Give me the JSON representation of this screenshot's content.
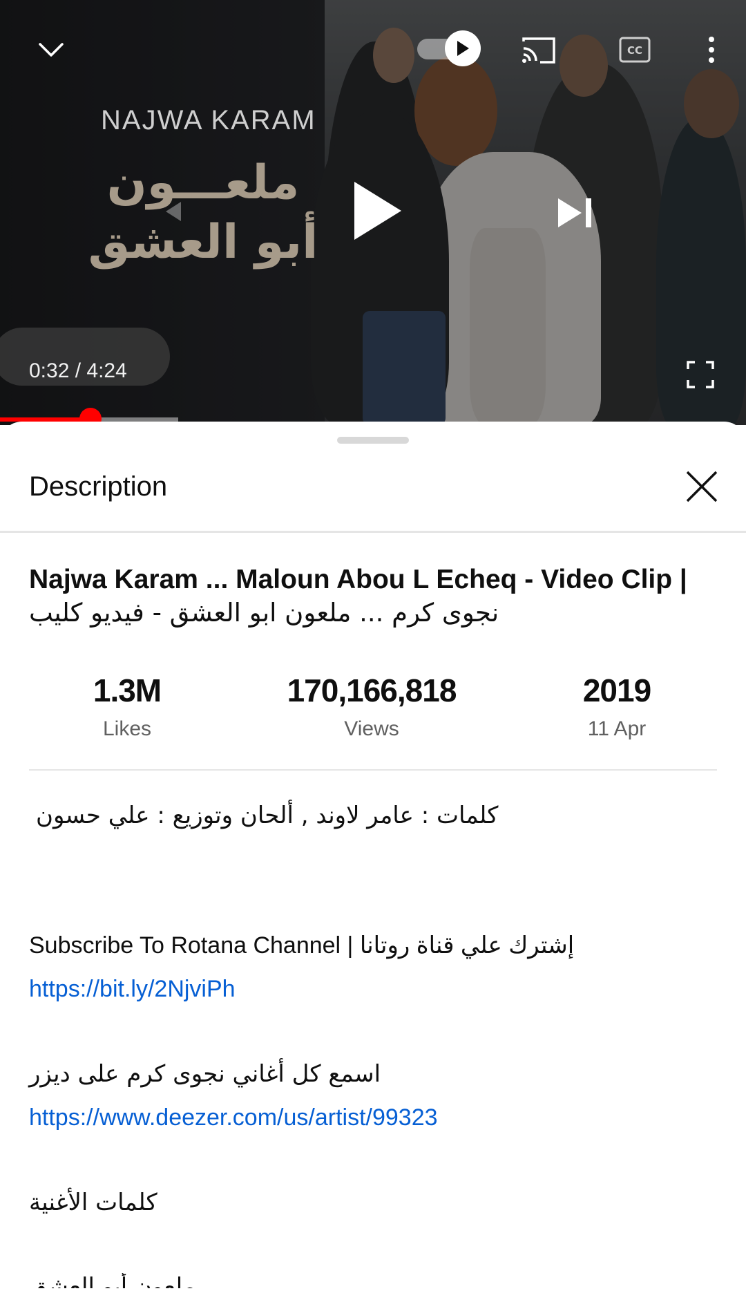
{
  "player": {
    "video_brand": "NAJWA KARAM",
    "video_title_ar_line1": "ملعـــون",
    "video_title_ar_line2": "أبو العشق",
    "time_display": "0:32 / 4:24",
    "current_time": "0:32",
    "duration": "4:24",
    "progress_fraction": 0.121,
    "accent_color": "#ff0000",
    "icons": {
      "minimize": "chevron-down-icon",
      "autoplay": "autoplay-toggle-icon",
      "cast": "cast-icon",
      "captions": "closed-captions-icon",
      "more": "more-vert-icon",
      "play": "play-icon",
      "next": "skip-next-icon",
      "fullscreen": "fullscreen-icon"
    }
  },
  "description": {
    "header": "Description",
    "close_icon": "close-icon",
    "title_line1": "Najwa Karam ... Maloun Abou L Echeq - Video Clip |",
    "title_line2": "نجوى كرم ... ملعون ابو العشق - فيديو كليب",
    "stats": [
      {
        "value": "1.3M",
        "label": "Likes"
      },
      {
        "value": "170,166,818",
        "label": "Views"
      },
      {
        "value": "2019",
        "label": "11 Apr"
      }
    ],
    "lines": {
      "credits": "كلمات : عامر لاوند , ألحان وتوزيع : علي حسون",
      "subscribe": "Subscribe To Rotana Channel | إشترك علي قناة روتانا",
      "subscribe_link": "https://bit.ly/2NjviPh",
      "deezer_text": "اسمع كل أغاني نجوى كرم على ديزر",
      "deezer_link": "https://www.deezer.com/us/artist/99323",
      "lyrics_heading": "كلمات الأغنية",
      "lyrics_first": "ملعون أبو العشق"
    },
    "link_color": "#065fd4"
  }
}
